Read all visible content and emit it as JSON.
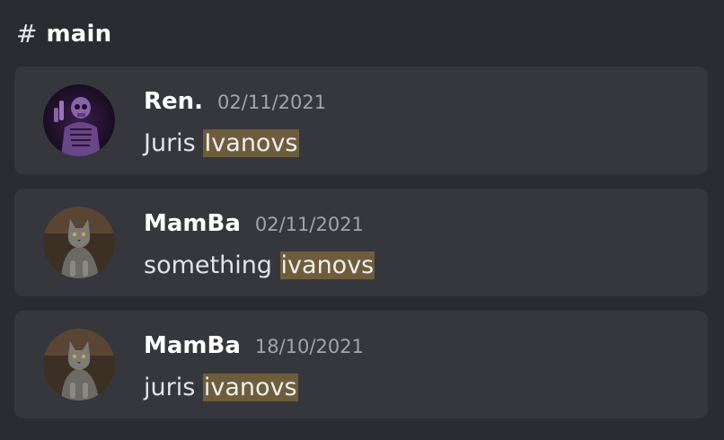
{
  "header": {
    "hash_symbol": "#",
    "channel_name": "main"
  },
  "colors": {
    "background": "#2b2c31",
    "card": "#36373d",
    "highlight": "#6e5d3c",
    "timestamp": "#a2a4aa"
  },
  "results": [
    {
      "author": "Ren.",
      "timestamp": "02/11/2021",
      "text_before": "Juris ",
      "highlight": "Ivanovs",
      "avatar_icon": "skeleton-avatar-icon"
    },
    {
      "author": "MamBa",
      "timestamp": "02/11/2021",
      "text_before": "something ",
      "highlight": "ivanovs",
      "avatar_icon": "cat-avatar-icon"
    },
    {
      "author": "MamBa",
      "timestamp": "18/10/2021",
      "text_before": "juris ",
      "highlight": "ivanovs",
      "avatar_icon": "cat-avatar-icon"
    }
  ]
}
